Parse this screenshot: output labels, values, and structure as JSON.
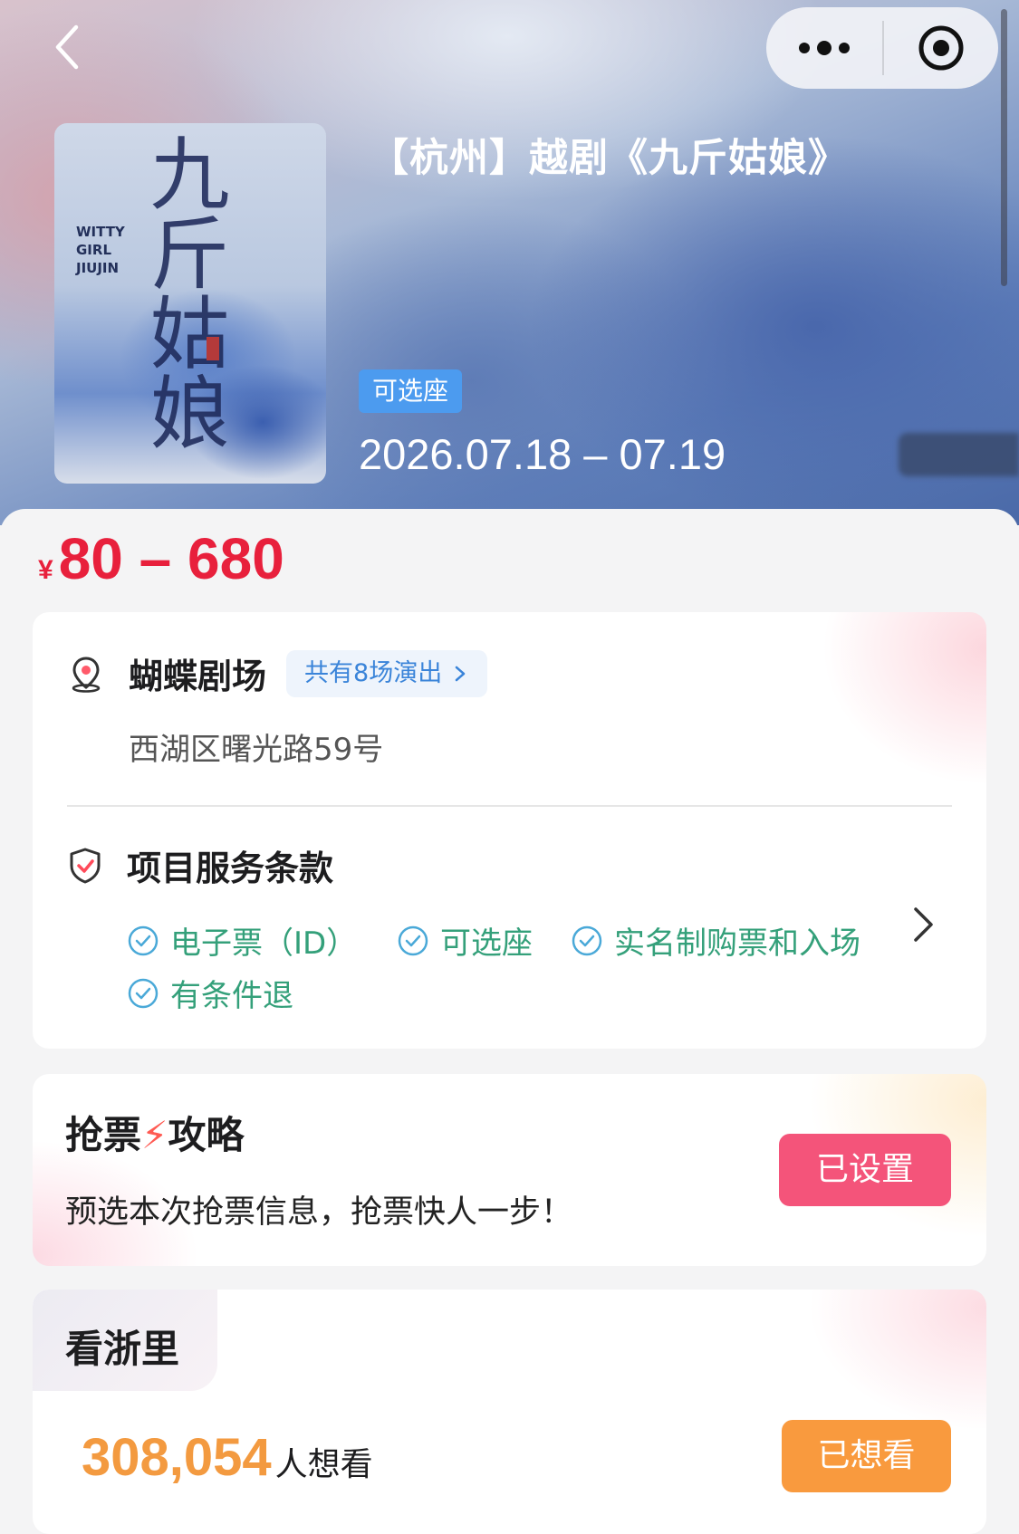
{
  "header": {
    "title": "【杭州】越剧《九斤姑娘》",
    "seat_tag": "可选座",
    "dates": "2026.07.18 – 07.19",
    "poster": {
      "english_title": [
        "WITTY",
        "GIRL",
        "JIUJIN"
      ],
      "chinese_title": "九斤姑娘"
    }
  },
  "price": {
    "currency": "¥",
    "range": "80 – 680",
    "color": "#e8203c"
  },
  "venue": {
    "name": "蝴蝶剧场",
    "shows_link": "共有8场演出",
    "address": "西湖区曙光路59号"
  },
  "services": {
    "title": "项目服务条款",
    "items": [
      "电子票（ID）",
      "可选座",
      "实名制购票和入场",
      "有条件退"
    ],
    "accent": "#34a07a"
  },
  "grab": {
    "title_prefix": "抢票",
    "title_bolt": "⚡",
    "title_suffix": "攻略",
    "desc": "预选本次抢票信息，抢票快人一步！",
    "button": "已设置",
    "button_color": "#f4547a"
  },
  "want": {
    "title": "看浙里",
    "count": "308,054",
    "unit": "人想看",
    "button": "已想看",
    "button_color": "#f99a3e"
  },
  "icons": {
    "back": "chevron-left-icon",
    "more": "more-dots-icon",
    "close": "target-close-icon",
    "location": "location-pin-icon",
    "shield": "shield-check-icon",
    "check": "check-circle-icon",
    "arrow": "chevron-right-icon"
  }
}
